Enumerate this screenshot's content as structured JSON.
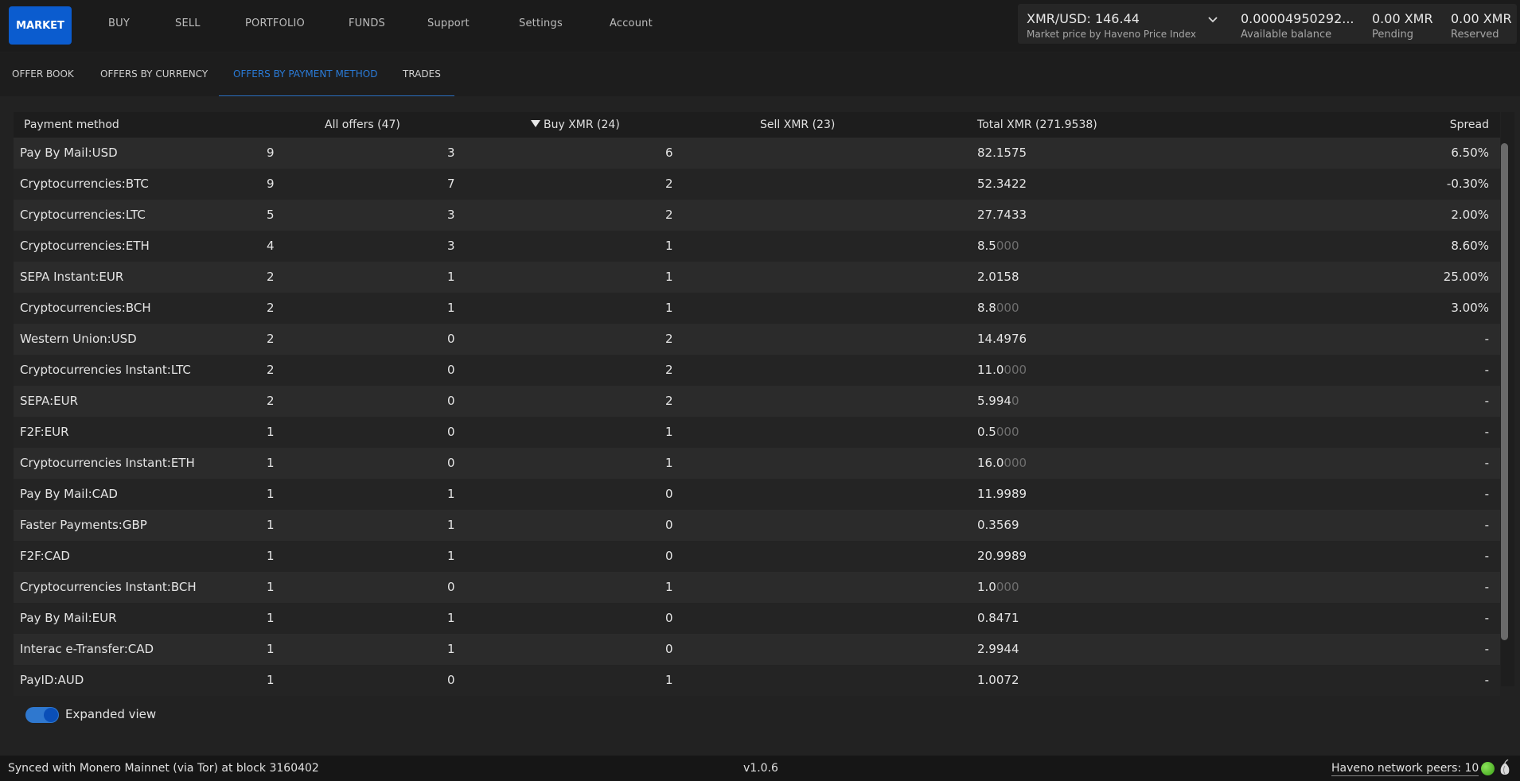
{
  "nav": {
    "items": [
      "MARKET",
      "BUY",
      "SELL",
      "PORTFOLIO",
      "FUNDS",
      "Support",
      "Settings",
      "Account"
    ]
  },
  "price": {
    "pair_value": "XMR/USD: 146.44",
    "pair_label": "Market price by Haveno Price Index",
    "available_value": "0.00004950292...",
    "available_label": "Available balance",
    "pending_value": "0.00 XMR",
    "pending_label": "Pending",
    "reserved_value": "0.00 XMR",
    "reserved_label": "Reserved"
  },
  "subtabs": [
    "OFFER BOOK",
    "OFFERS BY CURRENCY",
    "OFFERS BY PAYMENT METHOD",
    "TRADES"
  ],
  "table": {
    "headers": {
      "method": "Payment method",
      "all": "All offers (47)",
      "buy": "Buy XMR (24)",
      "sell": "Sell XMR (23)",
      "total": "Total XMR (271.9538)",
      "spread": "Spread"
    },
    "rows": [
      {
        "method": "Pay By Mail:USD",
        "all": "9",
        "buy": "3",
        "sell": "6",
        "total": "82.1575",
        "total_dim": "",
        "spread": "6.50%"
      },
      {
        "method": "Cryptocurrencies:BTC",
        "all": "9",
        "buy": "7",
        "sell": "2",
        "total": "52.3422",
        "total_dim": "",
        "spread": "-0.30%"
      },
      {
        "method": "Cryptocurrencies:LTC",
        "all": "5",
        "buy": "3",
        "sell": "2",
        "total": "27.7433",
        "total_dim": "",
        "spread": "2.00%"
      },
      {
        "method": "Cryptocurrencies:ETH",
        "all": "4",
        "buy": "3",
        "sell": "1",
        "total": "8.5",
        "total_dim": "000",
        "spread": "8.60%"
      },
      {
        "method": "SEPA Instant:EUR",
        "all": "2",
        "buy": "1",
        "sell": "1",
        "total": "2.0158",
        "total_dim": "",
        "spread": "25.00%"
      },
      {
        "method": "Cryptocurrencies:BCH",
        "all": "2",
        "buy": "1",
        "sell": "1",
        "total": "8.8",
        "total_dim": "000",
        "spread": "3.00%"
      },
      {
        "method": "Western Union:USD",
        "all": "2",
        "buy": "0",
        "sell": "2",
        "total": "14.4976",
        "total_dim": "",
        "spread": "-"
      },
      {
        "method": "Cryptocurrencies Instant:LTC",
        "all": "2",
        "buy": "0",
        "sell": "2",
        "total": "11.0",
        "total_dim": "000",
        "spread": "-"
      },
      {
        "method": "SEPA:EUR",
        "all": "2",
        "buy": "0",
        "sell": "2",
        "total": "5.994",
        "total_dim": "0",
        "spread": "-"
      },
      {
        "method": "F2F:EUR",
        "all": "1",
        "buy": "0",
        "sell": "1",
        "total": "0.5",
        "total_dim": "000",
        "spread": "-"
      },
      {
        "method": "Cryptocurrencies Instant:ETH",
        "all": "1",
        "buy": "0",
        "sell": "1",
        "total": "16.0",
        "total_dim": "000",
        "spread": "-"
      },
      {
        "method": "Pay By Mail:CAD",
        "all": "1",
        "buy": "1",
        "sell": "0",
        "total": "11.9989",
        "total_dim": "",
        "spread": "-"
      },
      {
        "method": "Faster Payments:GBP",
        "all": "1",
        "buy": "1",
        "sell": "0",
        "total": "0.3569",
        "total_dim": "",
        "spread": "-"
      },
      {
        "method": "F2F:CAD",
        "all": "1",
        "buy": "1",
        "sell": "0",
        "total": "20.9989",
        "total_dim": "",
        "spread": "-"
      },
      {
        "method": "Cryptocurrencies Instant:BCH",
        "all": "1",
        "buy": "0",
        "sell": "1",
        "total": "1.0",
        "total_dim": "000",
        "spread": "-"
      },
      {
        "method": "Pay By Mail:EUR",
        "all": "1",
        "buy": "1",
        "sell": "0",
        "total": "0.8471",
        "total_dim": "",
        "spread": "-"
      },
      {
        "method": "Interac e-Transfer:CAD",
        "all": "1",
        "buy": "1",
        "sell": "0",
        "total": "2.9944",
        "total_dim": "",
        "spread": "-"
      },
      {
        "method": "PayID:AUD",
        "all": "1",
        "buy": "0",
        "sell": "1",
        "total": "1.0072",
        "total_dim": "",
        "spread": "-"
      }
    ]
  },
  "toggle": {
    "label": "Expanded view",
    "on": true
  },
  "status": {
    "sync": "Synced with Monero Mainnet (via Tor) at block 3160402",
    "version": "v1.0.6",
    "peers": "Haveno network peers: 10"
  },
  "colors": {
    "accent": "#0b5ccf",
    "active_tab": "#2a7bd8",
    "peer_ok": "#5cc22a"
  }
}
